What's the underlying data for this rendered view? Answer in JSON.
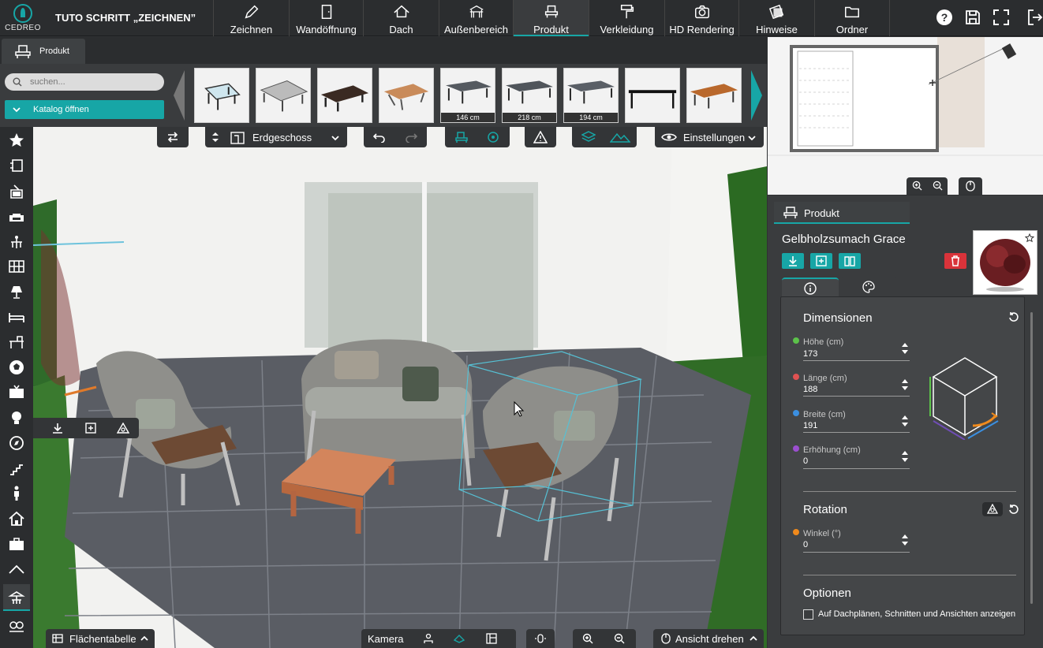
{
  "app": {
    "logo_text": "CEDREO",
    "project_title": "TUTO SCHRITT „ZEICHNEN”"
  },
  "nav_tabs": [
    {
      "label": "Zeichnen",
      "icon": "pencil-icon"
    },
    {
      "label": "Wandöffnung",
      "icon": "door-icon"
    },
    {
      "label": "Dach",
      "icon": "roof-icon"
    },
    {
      "label": "Außenbereich",
      "icon": "pergola-icon"
    },
    {
      "label": "Produkt",
      "icon": "armchair-icon",
      "active": true
    },
    {
      "label": "Verkleidung",
      "icon": "paint-roller-icon"
    },
    {
      "label": "HD Rendering",
      "icon": "camera-icon"
    },
    {
      "label": "Hinweise",
      "icon": "notes-icon"
    },
    {
      "label": "Ordner",
      "icon": "folder-icon"
    }
  ],
  "subtab": {
    "label": "Produkt"
  },
  "catalog": {
    "search_placeholder": "suchen...",
    "open_label": "Katalog öffnen",
    "thumbnails": [
      {
        "name": "glass-table",
        "dim": ""
      },
      {
        "name": "extendable-table",
        "dim": ""
      },
      {
        "name": "dark-wood-table",
        "dim": ""
      },
      {
        "name": "wood-metal-table",
        "dim": ""
      },
      {
        "name": "grey-table-146",
        "dim": "146 cm"
      },
      {
        "name": "grey-table-218",
        "dim": "218 cm"
      },
      {
        "name": "grey-table-194",
        "dim": "194 cm"
      },
      {
        "name": "black-table",
        "dim": ""
      },
      {
        "name": "teak-table",
        "dim": ""
      }
    ]
  },
  "toolbar": {
    "level_label": "Erdgeschoss",
    "settings_label": "Einstellungen"
  },
  "bottombar": {
    "area_table_label": "Flächentabelle",
    "camera_label": "Kamera",
    "rotate_view_label": "Ansicht drehen"
  },
  "panel": {
    "tab_label": "Produkt",
    "product_name": "Gelbholzsumach Grace",
    "dimensions_title": "Dimensionen",
    "fields": [
      {
        "label": "Höhe (cm)",
        "value": "173",
        "color": "#5cc24a"
      },
      {
        "label": "Länge (cm)",
        "value": "188",
        "color": "#e05252"
      },
      {
        "label": "Breite (cm)",
        "value": "191",
        "color": "#3b8fe0"
      },
      {
        "label": "Erhöhung (cm)",
        "value": "0",
        "color": "#9b4fd0"
      }
    ],
    "rotation_title": "Rotation",
    "angle_label": "Winkel (°)",
    "angle_value": "0",
    "angle_color": "#f08a1c",
    "options_title": "Optionen",
    "option_label": "Auf Dachplänen, Schnitten und Ansichten anzeigen"
  },
  "colors": {
    "accent": "#17a6a6",
    "danger": "#d9333a"
  }
}
